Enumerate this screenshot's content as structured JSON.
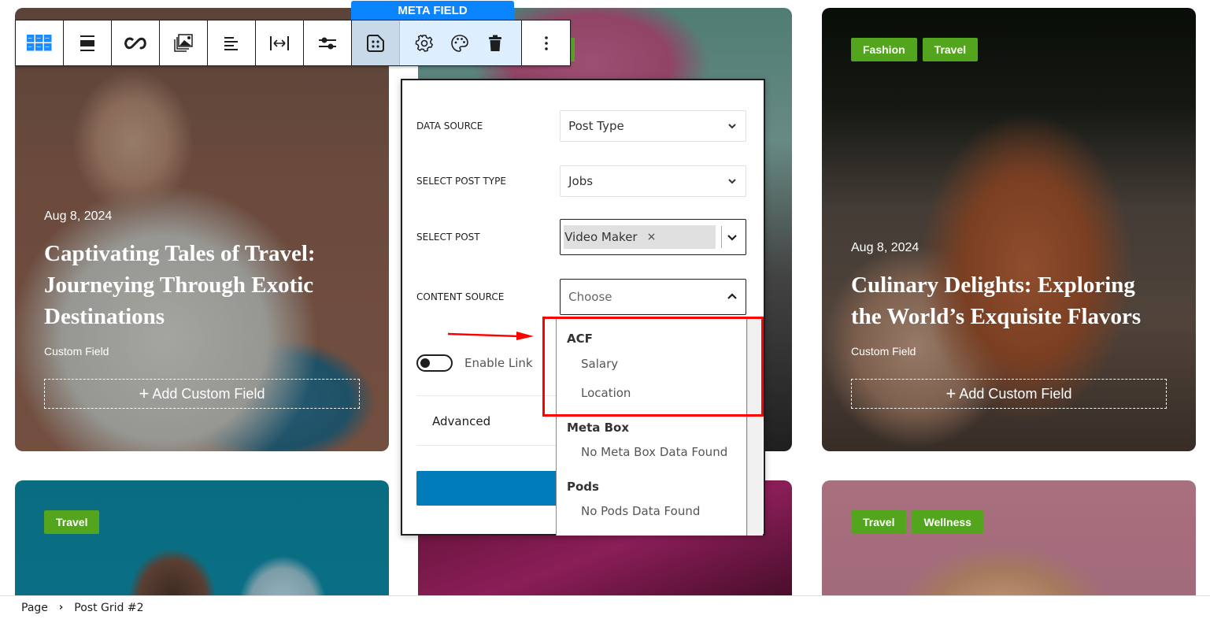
{
  "toolbar": {
    "block_label": "META FIELD",
    "buttons": [
      {
        "name": "post-grid",
        "icon": "grid-icon"
      },
      {
        "name": "layout",
        "icon": "block-layout-icon"
      },
      {
        "name": "link",
        "icon": "infinity-link-icon"
      },
      {
        "name": "media",
        "icon": "gallery-icon"
      },
      {
        "name": "align",
        "icon": "align-left-icon"
      },
      {
        "name": "width",
        "icon": "width-arrows-icon"
      },
      {
        "name": "settings-sliders",
        "icon": "sliders-icon"
      },
      {
        "name": "meta-field",
        "icon": "meta-field-icon",
        "active": true
      },
      {
        "name": "gear",
        "icon": "gear-icon"
      },
      {
        "name": "style",
        "icon": "palette-icon"
      },
      {
        "name": "delete",
        "icon": "trash-icon"
      },
      {
        "name": "more-options",
        "icon": "kebab-menu-icon"
      }
    ],
    "accent": "#0a84ff"
  },
  "cards": [
    {
      "tags": [],
      "date": "Aug 8, 2024",
      "title": "Captivating Tales of Travel: Journeying Through Exotic Destinations",
      "custom_field": "Custom Field",
      "add_custom_field": "Add Custom Field"
    },
    {
      "tags": [
        "Fashion",
        "Travel"
      ],
      "date": "Aug 8, 2024",
      "title": "Culinary Delights: Exploring the World’s Exquisite Flavors",
      "custom_field": "Custom Field",
      "add_custom_field": "Add Custom Field"
    },
    {
      "tags": [
        "Travel"
      ]
    },
    {
      "tags": [
        "Travel",
        "Wellness"
      ]
    }
  ],
  "tag_color": "#53a51d",
  "panel": {
    "fields": [
      {
        "label": "DATA SOURCE",
        "value": "Post Type"
      },
      {
        "label": "SELECT POST TYPE",
        "value": "Jobs"
      },
      {
        "label": "SELECT POST",
        "chip": "Video Maker",
        "chip_remove": "×"
      },
      {
        "label": "CONTENT SOURCE",
        "placeholder": "Choose"
      }
    ],
    "enable_link": {
      "label": "Enable Link",
      "checked": false
    },
    "advanced": "Advanced",
    "button_color": "#007cba"
  },
  "dropdown": {
    "groups": [
      {
        "label": "ACF",
        "items": [
          "Salary",
          "Location"
        ]
      },
      {
        "label": "Meta Box",
        "items": [
          "No Meta Box Data Found"
        ]
      },
      {
        "label": "Pods",
        "items": [
          "No Pods Data Found"
        ]
      }
    ]
  },
  "annotation": {
    "highlight_color": "#ff0000"
  },
  "breadcrumb": {
    "items": [
      "Page",
      "Post Grid #2"
    ],
    "separator": "›"
  }
}
